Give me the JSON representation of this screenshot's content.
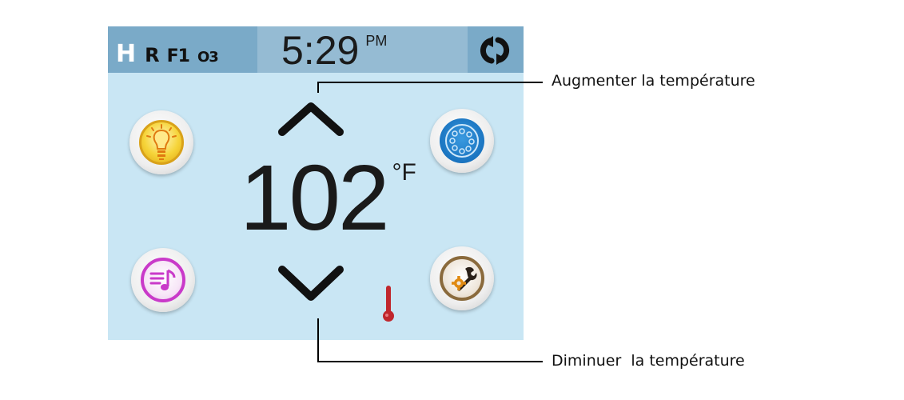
{
  "status_bar": {
    "flags": [
      {
        "label": "H"
      },
      {
        "label": "R"
      },
      {
        "label": "F1"
      },
      {
        "label": "O3"
      }
    ],
    "time": "5:29",
    "ampm": "PM",
    "sync_icon": "sync-icon"
  },
  "display": {
    "temperature": "102",
    "unit": "°F"
  },
  "buttons": {
    "light": "light-bulb-icon",
    "jets": "jets-icon",
    "music": "music-icon",
    "settings": "settings-icon",
    "temp_up": "chevron-up-icon",
    "temp_down": "chevron-down-icon",
    "heater": "thermometer-icon"
  },
  "callouts": {
    "up": "Augmenter la température",
    "down": "Diminuer  la température"
  },
  "colors": {
    "panel_bg": "#c9e6f4",
    "status_bar": "#7aaac8",
    "light_button": "#f3c61a",
    "jets_button": "#1a74c0",
    "music_button": "#c93ac9",
    "settings_button": "#8a6a3c",
    "thermometer": "#c0272d"
  }
}
